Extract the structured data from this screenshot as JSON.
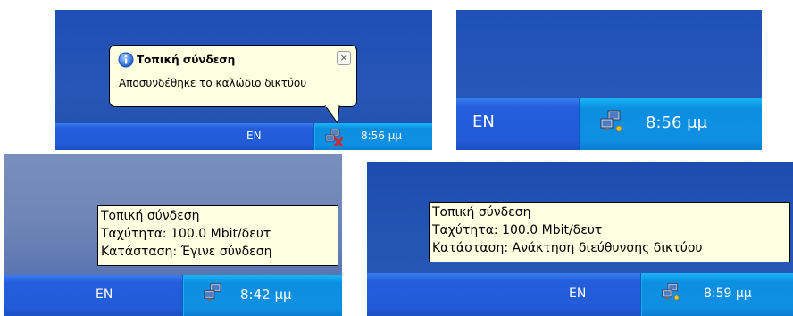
{
  "panel_a": {
    "balloon": {
      "title": "Τοπική σύνδεση",
      "message": "Αποσυνδέθηκε το καλώδιο δικτύου",
      "close_glyph": "×"
    },
    "taskbar": {
      "language": "EN",
      "clock": "8:56 μμ",
      "tray_icon": "network-disconnected-icon"
    }
  },
  "panel_b": {
    "taskbar": {
      "language": "EN",
      "clock": "8:56 μμ",
      "tray_icon": "network-connected-icon"
    }
  },
  "panel_c": {
    "tooltip": {
      "line1": "Τοπική σύνδεση",
      "line2": "Ταχύτητα: 100.0 Mbit/δευτ",
      "line3": "Κατάσταση: Έγινε σύνδεση"
    },
    "taskbar": {
      "language": "EN",
      "clock": "8:42 μμ",
      "tray_icon": "network-connected-icon"
    }
  },
  "panel_d": {
    "tooltip": {
      "line1": "Τοπική σύνδεση",
      "line2": "Ταχύτητα: 100.0 Mbit/δευτ",
      "line3": "Κατάσταση: Ανάκτηση διεύθυνσης δικτύου"
    },
    "taskbar": {
      "language": "EN",
      "clock": "8:59 μμ",
      "tray_icon": "network-connected-icon"
    }
  },
  "colors": {
    "taskbar_blue": "#245edc",
    "tray_blue": "#0f8fe3",
    "tooltip_bg": "#ffffe1"
  }
}
